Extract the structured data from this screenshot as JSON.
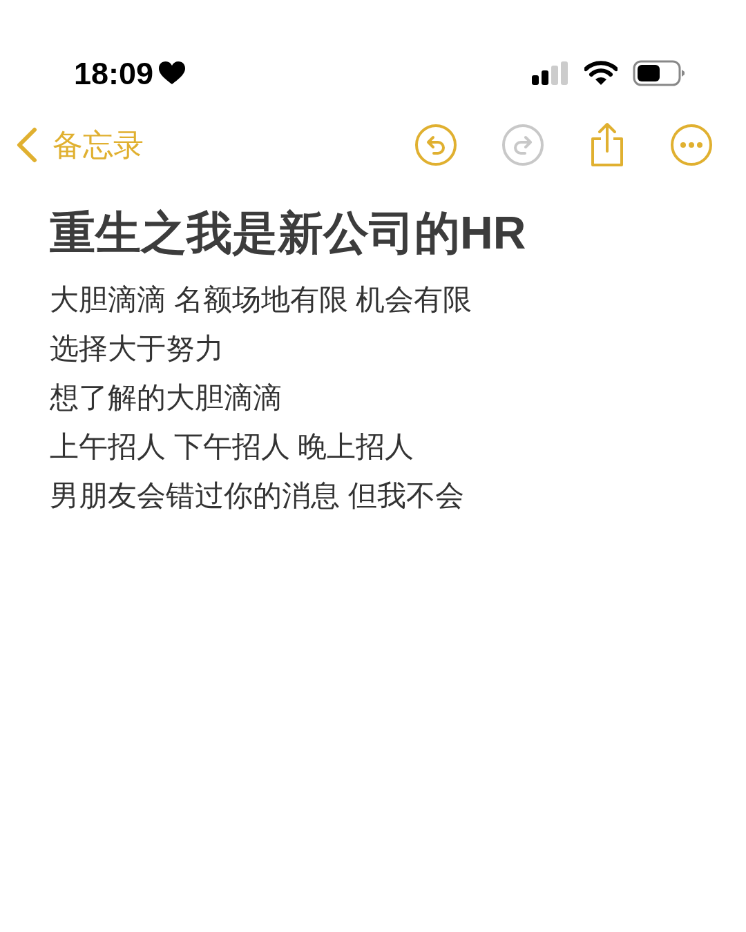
{
  "status_bar": {
    "time": "18:09"
  },
  "nav": {
    "back_label": "备忘录",
    "toolbar": [
      {
        "kind": "undo",
        "disabled": false
      },
      {
        "kind": "redo",
        "disabled": true
      },
      {
        "kind": "share",
        "disabled": false
      },
      {
        "kind": "more",
        "disabled": false
      }
    ]
  },
  "note": {
    "title": "重生之我是新公司的HR",
    "lines": [
      "大胆滴滴 名额场地有限 机会有限",
      "选择大于努力",
      "想了解的大胆滴滴",
      "上午招人 下午招人 晚上招人",
      "男朋友会错过你的消息 但我不会"
    ]
  }
}
